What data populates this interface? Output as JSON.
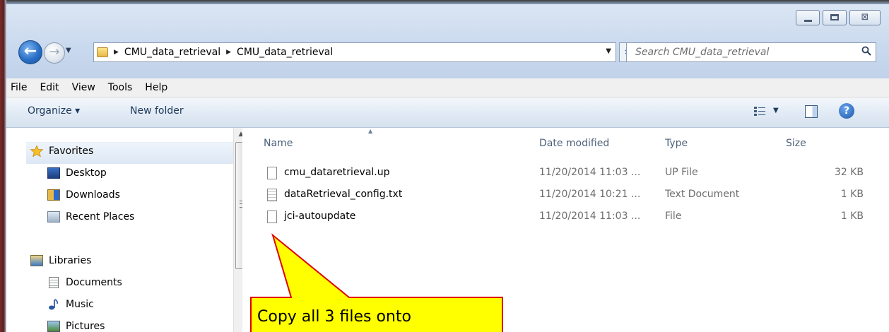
{
  "window": {
    "controls": {
      "minimize": "",
      "maximize": "",
      "close": "⊠"
    }
  },
  "address": {
    "crumbs": [
      "CMU_data_retrieval",
      "CMU_data_retrieval"
    ]
  },
  "search": {
    "placeholder": "Search CMU_data_retrieval"
  },
  "menu": [
    "File",
    "Edit",
    "View",
    "Tools",
    "Help"
  ],
  "toolbar": {
    "organize": "Organize ▾",
    "new_folder": "New folder"
  },
  "nav": {
    "favorites": "Favorites",
    "desktop": "Desktop",
    "downloads": "Downloads",
    "recent": "Recent Places",
    "libraries": "Libraries",
    "documents": "Documents",
    "music": "Music",
    "pictures": "Pictures"
  },
  "columns": {
    "name": "Name",
    "date": "Date modified",
    "type": "Type",
    "size": "Size"
  },
  "files": [
    {
      "name": "cmu_dataretrieval.up",
      "date": "11/20/2014 11:03 ...",
      "type": "UP File",
      "size": "32 KB"
    },
    {
      "name": "dataRetrieval_config.txt",
      "date": "11/20/2014 10:21 ...",
      "type": "Text Document",
      "size": "1 KB"
    },
    {
      "name": "jci-autoupdate",
      "date": "11/20/2014 11:03 ...",
      "type": "File",
      "size": "1 KB"
    }
  ],
  "callout": {
    "text": "Copy all 3 files onto",
    "fill": "#ffff00",
    "stroke": "#e00000"
  }
}
